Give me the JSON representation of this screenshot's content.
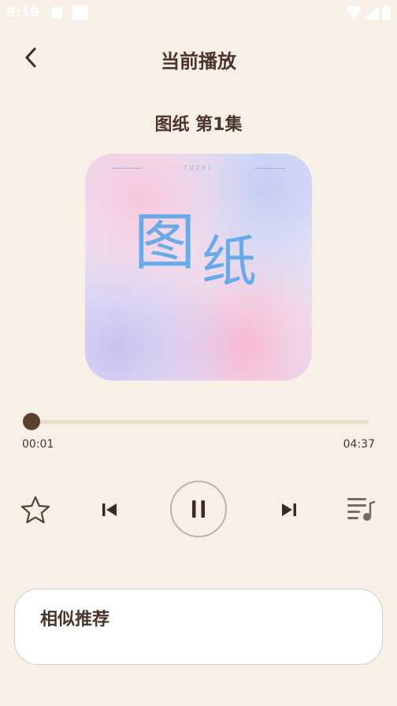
{
  "status_bar": {
    "time": "9:19"
  },
  "header": {
    "title": "当前播放"
  },
  "episode": {
    "title": "图纸 第1集"
  },
  "cover": {
    "tag": "TUZHI",
    "char1": "图",
    "char2": "纸"
  },
  "player": {
    "current_time": "00:01",
    "total_time": "04:37",
    "progress": 0.004,
    "state": "playing"
  },
  "controls": {
    "favorite_icon": "star-outline-icon",
    "prev_icon": "skip-previous-icon",
    "play_icon": "pause-icon",
    "next_icon": "skip-next-icon",
    "playlist_icon": "playlist-music-icon"
  },
  "recommend": {
    "title": "相似推荐"
  },
  "colors": {
    "background": "#f8f0e7",
    "accent": "#5b4130",
    "track": "#ecdccb",
    "text": "#4a3528"
  }
}
